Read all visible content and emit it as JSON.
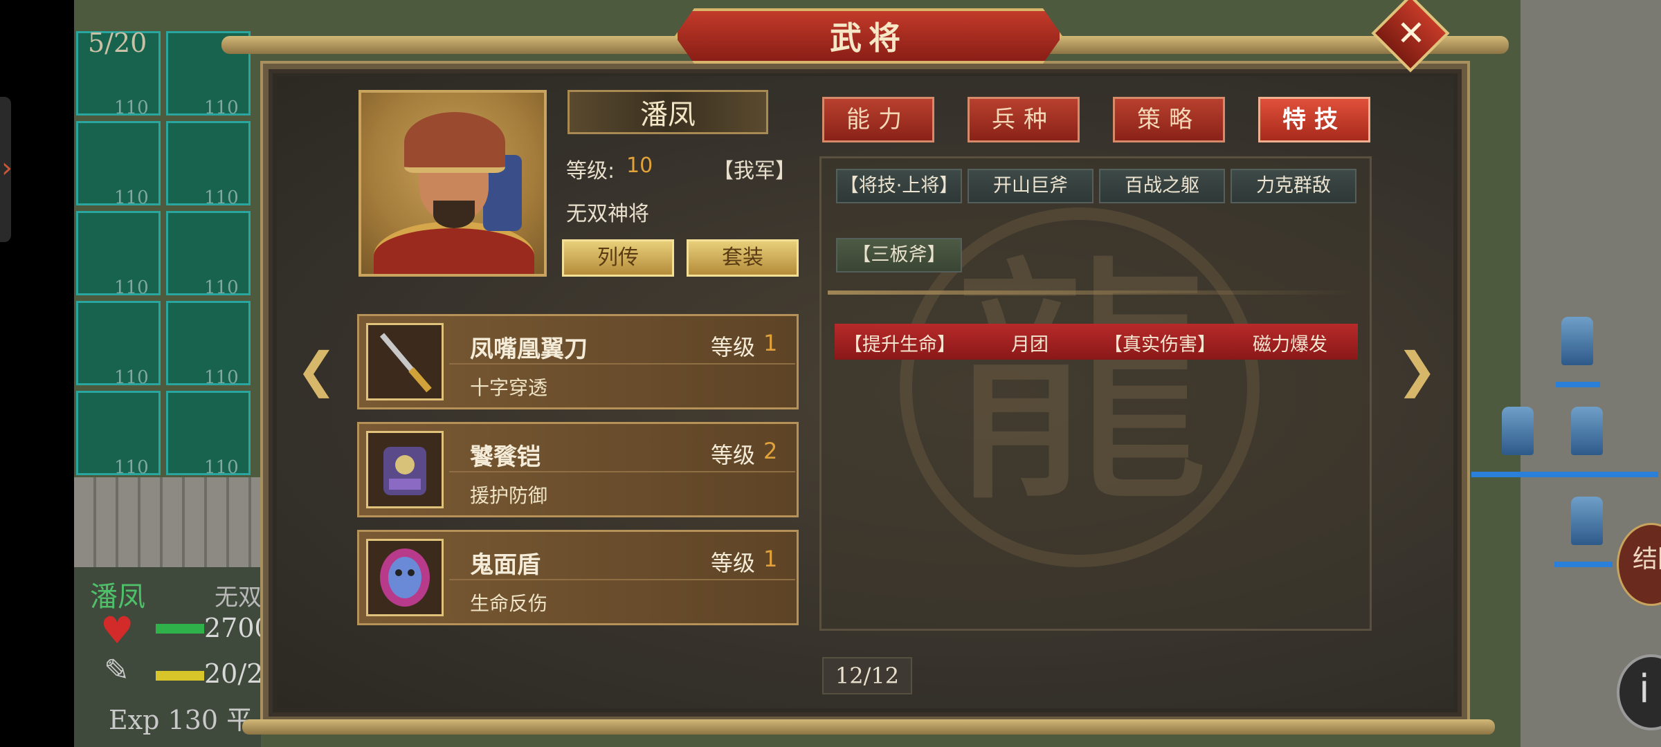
{
  "hud": {
    "turn_counter": "5/20",
    "unit_name": "潘凤",
    "unit_title": "无双",
    "hp_text": "2700",
    "mp_text": "20/2",
    "exp_text": "Exp 130 平",
    "tile_value": "110",
    "round_button_label": "结回",
    "info_button_label": "i"
  },
  "dialog": {
    "title": "武将",
    "close_label": "✕"
  },
  "hero": {
    "name": "潘凤",
    "level_label": "等级:",
    "level_value": "10",
    "faction": "【我军】",
    "title": "无双神将",
    "biography_label": "列传",
    "outfit_label": "套装"
  },
  "equipment": [
    {
      "name": "凤嘴凰翼刀",
      "level_label": "等级",
      "level": "1",
      "skill": "十字穿透",
      "icon": "blade-icon"
    },
    {
      "name": "饕餮铠",
      "level_label": "等级",
      "level": "2",
      "skill": "援护防御",
      "icon": "armor-icon"
    },
    {
      "name": "鬼面盾",
      "level_label": "等级",
      "level": "1",
      "skill": "生命反伤",
      "icon": "shield-icon"
    }
  ],
  "tabs": [
    {
      "label": "能力",
      "active": false
    },
    {
      "label": "兵种",
      "active": false
    },
    {
      "label": "策略",
      "active": false
    },
    {
      "label": "特技",
      "active": true
    }
  ],
  "skills": {
    "row1": [
      "【将技·上将】",
      "开山巨斧",
      "百战之躯",
      "力克群敌"
    ],
    "row2": [
      "【三板斧】"
    ],
    "effects": [
      "【提升生命】",
      "月团",
      "【真实伤害】",
      "磁力爆发"
    ]
  },
  "pagination": "12/12",
  "colors": {
    "accent_red": "#b82a2a",
    "gold": "#d7b86a",
    "level_orange": "#e1a23a"
  }
}
